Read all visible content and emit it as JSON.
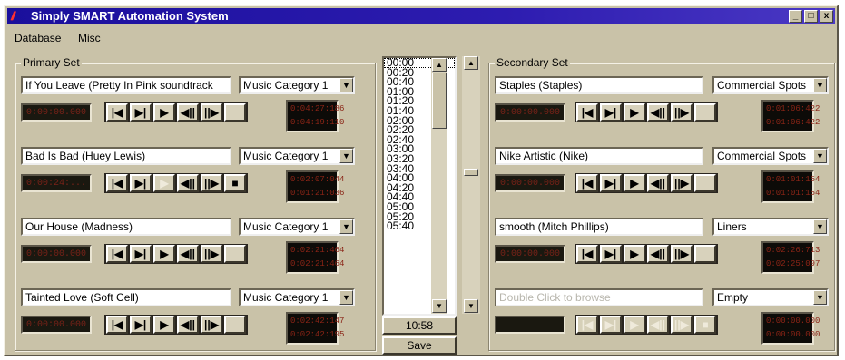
{
  "window": {
    "title": "Simply SMART Automation System",
    "controls": {
      "minimize": "_",
      "maximize": "□",
      "close": "x"
    }
  },
  "menu": {
    "database": "Database",
    "misc": "Misc"
  },
  "primary": {
    "label": "Primary Set",
    "decks": [
      {
        "title": "If You Leave (Pretty In Pink soundtrack",
        "category": "Music Category 1",
        "timer": "0:00:00.000",
        "clock": [
          "0:04:27:186",
          "0:04:19:110"
        ]
      },
      {
        "title": "Bad Is Bad (Huey Lewis)",
        "category": "Music Category 1",
        "timer": "0:00:24:...",
        "clock": [
          "0:02:07:044",
          "0:01:21:036"
        ]
      },
      {
        "title": "Our House (Madness)",
        "category": "Music Category 1",
        "timer": "0:00:00.000",
        "clock": [
          "0:02:21:464",
          "0:02:21:464"
        ]
      },
      {
        "title": "Tainted Love (Soft Cell)",
        "category": "Music Category 1",
        "timer": "0:00:00.000",
        "clock": [
          "0:02:42:147",
          "0:02:42:195"
        ]
      }
    ]
  },
  "secondary": {
    "label": "Secondary Set",
    "decks": [
      {
        "title": "Staples (Staples)",
        "category": "Commercial Spots",
        "timer": "0:00:00.000",
        "clock": [
          "0:01:06:422",
          "0:01:06:422"
        ],
        "placeholder": false
      },
      {
        "title": "Nike Artistic (Nike)",
        "category": "Commercial Spots",
        "timer": "0:00:00.000",
        "clock": [
          "0:01:01:154",
          "0:01:01:154"
        ],
        "placeholder": false
      },
      {
        "title": "smooth (Mitch Phillips)",
        "category": "Liners",
        "timer": "0:00:00.000",
        "clock": [
          "0:02:26:713",
          "0:02:25:097"
        ],
        "placeholder": false
      },
      {
        "title": "Double Click to browse",
        "category": "Empty",
        "timer": "",
        "clock": [
          "0:00:00.000",
          "0:00:00.000"
        ],
        "placeholder": true
      }
    ]
  },
  "transport_icons": [
    "skip-to-start-icon",
    "skip-to-end-icon",
    "play-icon",
    "rewind-icon",
    "fast-forward-icon",
    "stop-icon"
  ],
  "transport_glyphs": [
    "|◀",
    "▶|",
    "▶",
    "◀||",
    "||▶",
    "■"
  ],
  "time_list": [
    "00:00",
    "00:20",
    "00:40",
    "01:00",
    "01:20",
    "01:40",
    "02:00",
    "02:20",
    "02:40",
    "03:00",
    "03:20",
    "03:40",
    "04:00",
    "04:20",
    "04:40",
    "05:00",
    "05:20",
    "05:40"
  ],
  "current_time": "10:58",
  "save_label": "Save"
}
